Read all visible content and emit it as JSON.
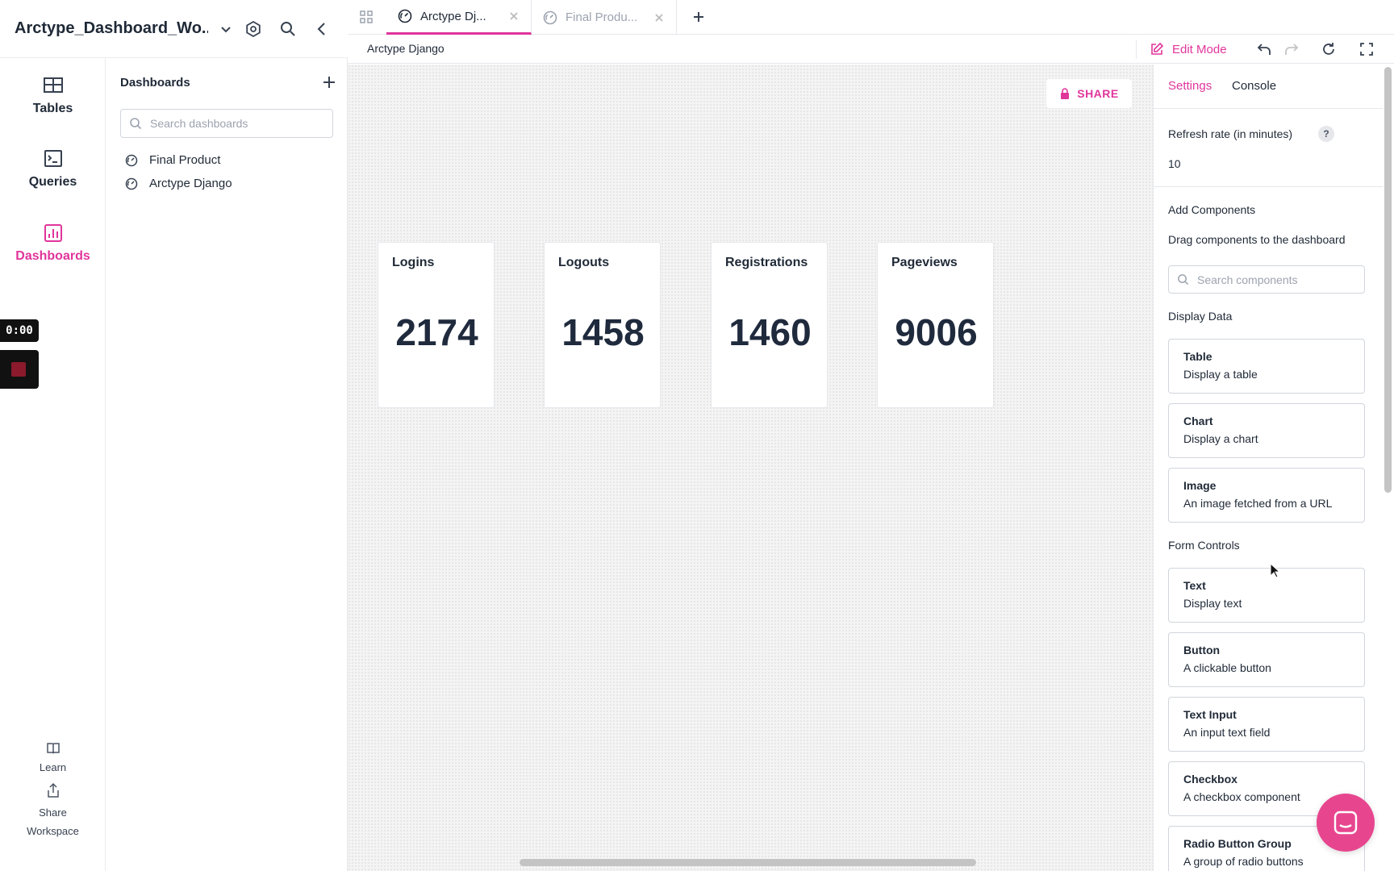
{
  "workspace": {
    "title": "Arctype_Dashboard_Wo..."
  },
  "rail": {
    "items": [
      {
        "label": "Tables",
        "icon": "table-icon"
      },
      {
        "label": "Queries",
        "icon": "terminal-icon"
      },
      {
        "label": "Dashboards",
        "icon": "bar-chart-icon",
        "active": true
      }
    ],
    "learn_label": "Learn",
    "share_workspace_label": "Share Workspace"
  },
  "recorder": {
    "time": "0:00"
  },
  "dashboards_panel": {
    "title": "Dashboards",
    "search_placeholder": "Search dashboards",
    "items": [
      {
        "label": "Final Product"
      },
      {
        "label": "Arctype Django"
      }
    ]
  },
  "tabs": [
    {
      "label": "Arctype Dj...",
      "active": true
    },
    {
      "label": "Final Produ...",
      "active": false
    }
  ],
  "subbar": {
    "breadcrumb": "Arctype Django",
    "edit_mode_label": "Edit Mode"
  },
  "canvas": {
    "share_label": "SHARE",
    "stats": [
      {
        "label": "Logins",
        "value": "2174"
      },
      {
        "label": "Logouts",
        "value": "1458"
      },
      {
        "label": "Registrations",
        "value": "1460"
      },
      {
        "label": "Pageviews",
        "value": "9006"
      }
    ]
  },
  "settings": {
    "tabs": {
      "settings": "Settings",
      "console": "Console"
    },
    "refresh_label": "Refresh rate (in minutes)",
    "help_label": "?",
    "refresh_value": "10",
    "add_components_title": "Add Components",
    "add_components_hint": "Drag components to the dashboard",
    "search_placeholder": "Search components",
    "display_data_title": "Display Data",
    "display_data": [
      {
        "name": "Table",
        "desc": "Display a table"
      },
      {
        "name": "Chart",
        "desc": "Display a chart"
      },
      {
        "name": "Image",
        "desc": "An image fetched from a URL"
      }
    ],
    "form_controls_title": "Form Controls",
    "form_controls": [
      {
        "name": "Text",
        "desc": "Display text"
      },
      {
        "name": "Button",
        "desc": "A clickable button"
      },
      {
        "name": "Text Input",
        "desc": "An input text field"
      },
      {
        "name": "Checkbox",
        "desc": "A checkbox component"
      },
      {
        "name": "Radio Button Group",
        "desc": "A group of radio buttons"
      }
    ]
  },
  "colors": {
    "accent": "#e0359b",
    "chat": "#e7468f"
  }
}
